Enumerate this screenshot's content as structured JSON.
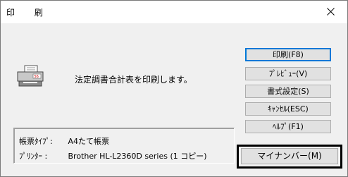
{
  "window": {
    "title": "印 刷",
    "close_label": "×"
  },
  "message": "法定調書合計表を印刷します。",
  "buttons": {
    "print": "印刷(F8)",
    "preview": "ﾌﾟﾚﾋﾞｭｰ(V)",
    "format": "書式設定(S)",
    "cancel": "ｷｬﾝｾﾙ(ESC)",
    "help": "ﾍﾙﾌﾟ(F1)",
    "mynumber": "マイナンバー(M)"
  },
  "info": {
    "form_type_label": "帳票ﾀｲﾌﾟ:",
    "form_type_value": "A4たて帳票",
    "printer_label": "ﾌﾟﾘﾝﾀｰ  :",
    "printer_value": "Brother HL-L2360D series (1 コピー)"
  },
  "icons": {
    "printer": "printer-icon",
    "close": "close-icon"
  }
}
